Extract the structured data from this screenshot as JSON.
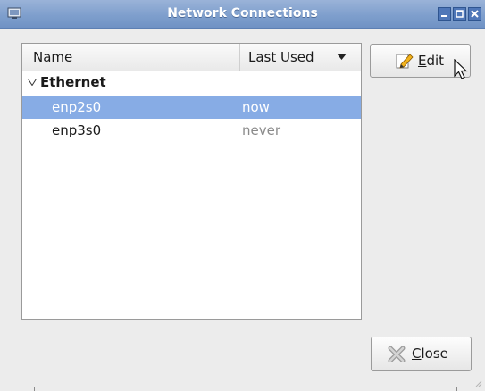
{
  "window": {
    "title": "Network Connections"
  },
  "table": {
    "columns": [
      "Name",
      "Last Used"
    ],
    "sort_indicator": "sort-descending-icon",
    "groups": [
      {
        "label": "Ethernet",
        "rows": [
          {
            "name": "enp2s0",
            "last_used": "now",
            "selected": true
          },
          {
            "name": "enp3s0",
            "last_used": "never",
            "selected": false
          }
        ]
      }
    ]
  },
  "buttons": {
    "edit_mnemonic": "E",
    "edit_rest": "dit",
    "close_mnemonic": "C",
    "close_rest": "lose"
  },
  "colors": {
    "titlebar": "#7f9fcd",
    "selection": "#87ace5",
    "muted_text": "#8a8a8a"
  }
}
